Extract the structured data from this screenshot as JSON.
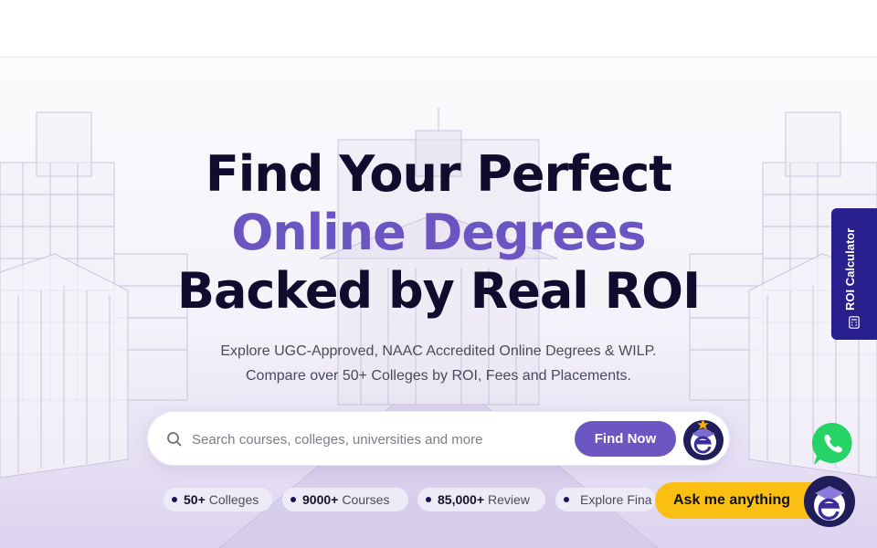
{
  "hero": {
    "headline_line1": "Find Your Perfect",
    "headline_line2": "Online Degrees",
    "headline_line3": "Backed by Real ROI",
    "subtitle_line1": "Explore UGC-Approved, NAAC Accredited Online Degrees & WILP.",
    "subtitle_line2": "Compare over 50+ Colleges by ROI, Fees and Placements."
  },
  "search": {
    "placeholder": "Search courses, colleges, universities and more",
    "value": "",
    "button_label": "Find Now",
    "assistant_icon": "graduation-bot-icon"
  },
  "stats": [
    {
      "value": "50+",
      "label": "Colleges"
    },
    {
      "value": "9000+",
      "label": "Courses"
    },
    {
      "value": "85,000+",
      "label": "Review"
    },
    {
      "value": "",
      "label": "Explore Fina"
    }
  ],
  "side_tab": {
    "label": "ROI Calculator",
    "icon": "calculator-icon"
  },
  "floating": {
    "whatsapp_icon": "whatsapp-icon",
    "ask_label": "Ask me anything",
    "bot_icon": "graduation-bot-icon"
  },
  "colors": {
    "primary": "#6b56c2",
    "navy": "#2a1f8e",
    "headline_dark": "#100c2e",
    "whatsapp": "#25d366",
    "ask_yellow": "#fbbf14"
  }
}
